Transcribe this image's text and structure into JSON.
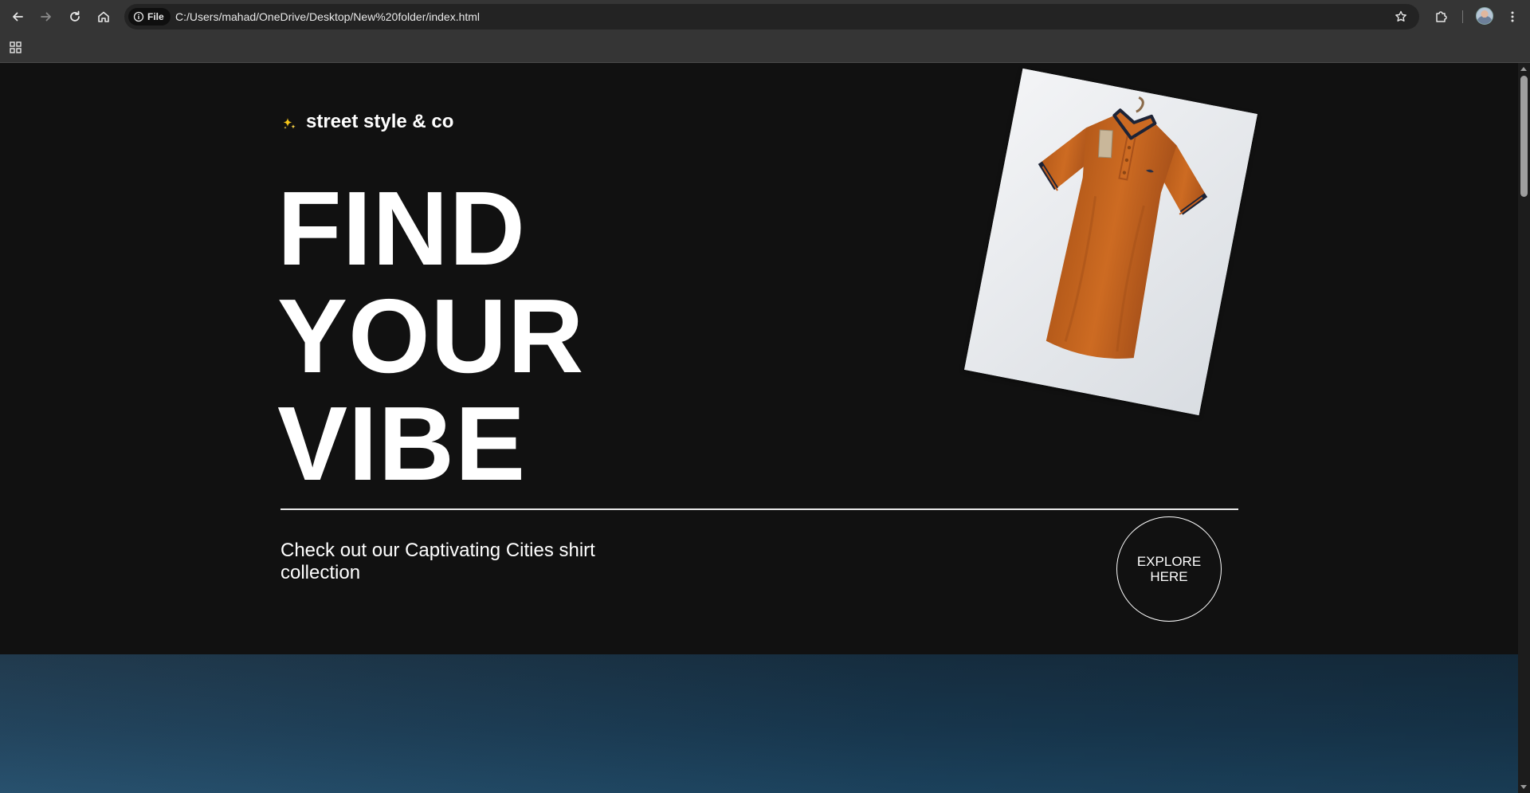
{
  "browser": {
    "site_chip_label": "File",
    "url": "C:/Users/mahad/OneDrive/Desktop/New%20folder/index.html",
    "icons": {
      "back": "arrow-left-icon",
      "forward": "arrow-right-icon",
      "reload": "reload-icon",
      "home": "home-icon",
      "site_info": "info-icon",
      "bookmark": "star-icon",
      "extensions": "puzzle-icon",
      "menu": "kebab-menu-icon",
      "apps": "apps-grid-icon"
    }
  },
  "hero": {
    "brand_name": "street style & co",
    "brand_icon": "sparkle-icon",
    "headline": [
      "FIND",
      "YOUR",
      "VIBE"
    ],
    "tagline": "Check out our Captivating Cities shirt collection",
    "cta_label": "EXPLORE HERE",
    "product_image": "orange-polo-shirt-on-hanger"
  },
  "colors": {
    "page_background": "#111111",
    "text": "#ffffff",
    "accent_sparkle": "#f5c518",
    "shirt": "#c8661f",
    "next_section": "#1a3d57"
  }
}
